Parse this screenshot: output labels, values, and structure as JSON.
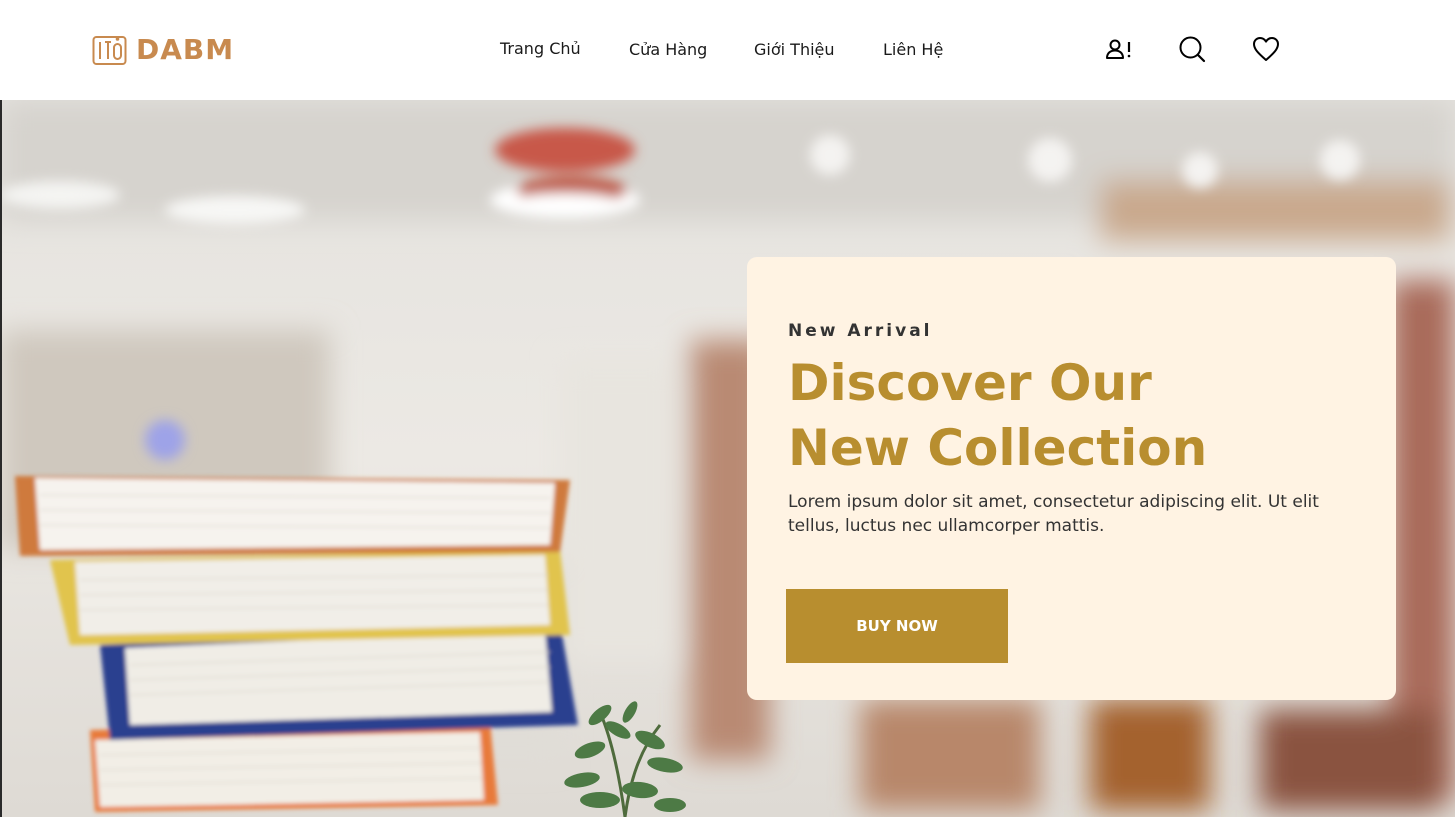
{
  "brand": {
    "name": "DABM",
    "color": "#c88a4f"
  },
  "nav": {
    "items": [
      {
        "label": "Trang Chủ"
      },
      {
        "label": "Cửa Hàng"
      },
      {
        "label": "Giới Thiệu"
      },
      {
        "label": "Liên Hệ"
      }
    ]
  },
  "header_icons": [
    "account-alert-icon",
    "search-icon",
    "heart-icon"
  ],
  "hero": {
    "eyebrow": "New Arrival",
    "headline_line1": "Discover Our",
    "headline_line2": "New Collection",
    "description": "Lorem ipsum dolor sit amet, consectetur adipiscing elit. Ut elit tellus, luctus nec ullamcorper mattis.",
    "cta_label": "BUY NOW",
    "accent_color": "#b88e2f",
    "card_color": "#fff3e3"
  }
}
